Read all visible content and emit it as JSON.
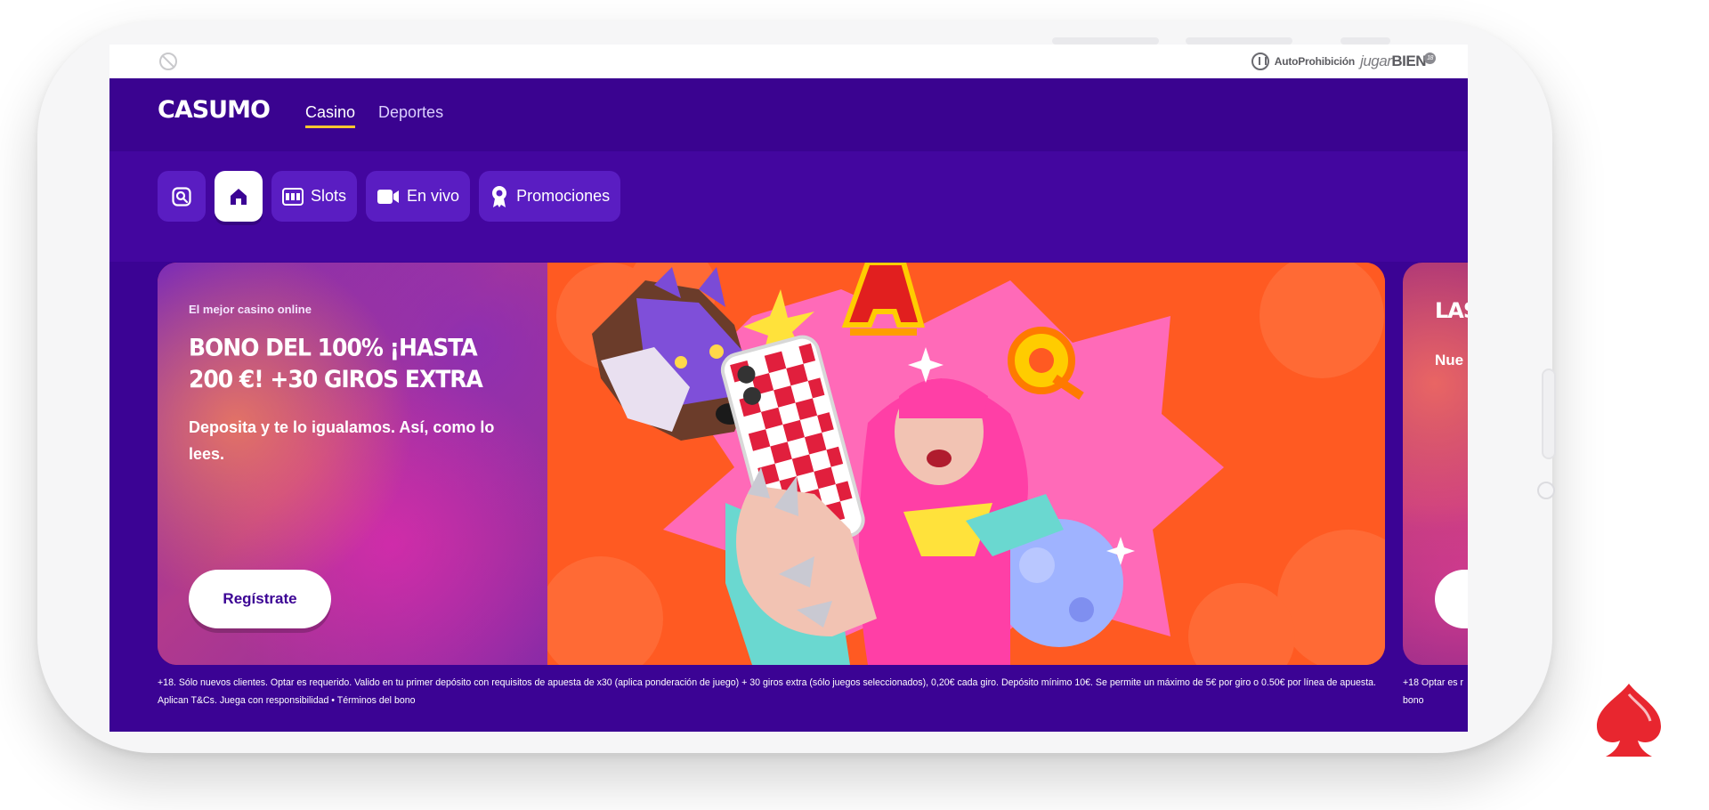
{
  "status_bar": {
    "autoprohibicion_label": "AutoProhibición",
    "jugarbien_prefix": "jugar",
    "jugarbien_suffix": "BIEN"
  },
  "header": {
    "logo": "CASUMO",
    "nav": [
      {
        "label": "Casino",
        "active": true
      },
      {
        "label": "Deportes",
        "active": false
      }
    ]
  },
  "chips": [
    {
      "icon": "search-icon",
      "label": ""
    },
    {
      "icon": "home-icon",
      "label": ""
    },
    {
      "icon": "slots-icon",
      "label": "Slots"
    },
    {
      "icon": "video-camera-icon",
      "label": "En vivo"
    },
    {
      "icon": "award-ribbon-icon",
      "label": "Promociones"
    }
  ],
  "hero": {
    "kicker": "El mejor casino online",
    "title": "BONO DEL 100% ¡HASTA 200 €! +30 GIROS EXTRA",
    "description": "Deposita y te lo igualamos. Así, como lo lees.",
    "cta": "Regístrate",
    "terms": "+18. Sólo nuevos clientes. Optar es requerido. Valido en tu primer depósito con requisitos de apuesta de x30 (aplica ponderación de juego) + 30 giros extra (sólo juegos seleccionados), 0,20€ cada giro. Depósito mínimo 10€. Se permite un máximo de 5€ por giro o 0.50€ por línea de apuesta. Aplican T&Cs. Juega con responsibilidad • Términos del bono"
  },
  "peek_card": {
    "title": "LAS",
    "subtitle": "Nue",
    "terms_line1": "+18 Optar es r",
    "terms_line2": "bono"
  },
  "colors": {
    "brand_purple": "#3b0394",
    "chip_purple": "#5a1dc2",
    "nav_underline": "#ffc82f",
    "hero_orange": "#ff5a22",
    "spade_red": "#e8262f"
  }
}
